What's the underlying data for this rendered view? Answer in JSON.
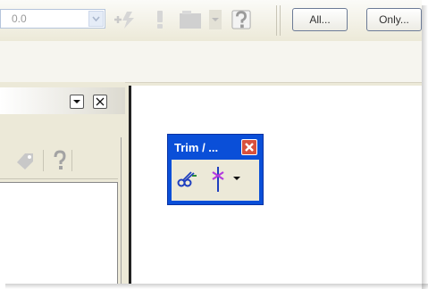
{
  "toolbar": {
    "combo_value": "0.0",
    "all_button_label": "All...",
    "only_button_label": "Only..."
  },
  "panel": {
    "help_icon_glyph": "?"
  },
  "floating_toolbar": {
    "title": "Trim / ...",
    "close_glyph": "✕"
  },
  "colors": {
    "title_bar": "#0a4fd8",
    "close_button": "#d8513d",
    "chrome": "#ece9d8"
  }
}
